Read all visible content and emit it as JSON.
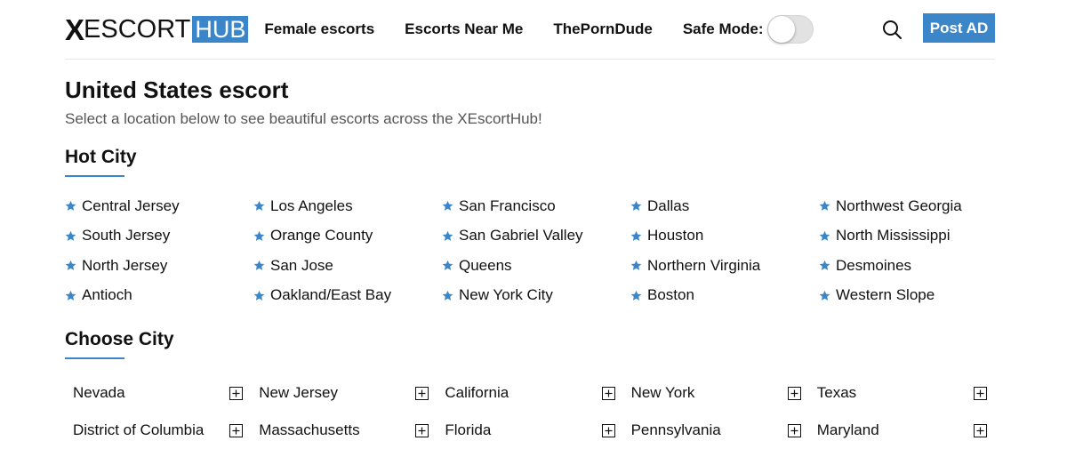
{
  "header": {
    "logo_x": "X",
    "logo_escort": "ESCORT",
    "logo_hub": "HUB",
    "nav": [
      "Female escorts",
      "Escorts Near Me",
      "ThePornDude"
    ],
    "safe_mode_label": "Safe Mode:",
    "safe_mode_on": false,
    "post_label": "Post AD",
    "accent_color": "#3a86c8"
  },
  "page": {
    "title": "United States escort",
    "subtitle": "Select a location below to see beautiful escorts across the XEscortHub!"
  },
  "hot_city": {
    "heading": "Hot City",
    "rows": [
      [
        "Central Jersey",
        "Los Angeles",
        "San Francisco",
        "Dallas",
        "Northwest Georgia"
      ],
      [
        "South Jersey",
        "Orange County",
        "San Gabriel Valley",
        "Houston",
        "North Mississippi"
      ],
      [
        "North Jersey",
        "San Jose",
        "Queens",
        "Northern Virginia",
        "Desmoines"
      ],
      [
        "Antioch",
        "Oakland/East Bay",
        "New York City",
        "Boston",
        "Western Slope"
      ]
    ]
  },
  "choose_city": {
    "heading": "Choose City",
    "rows": [
      [
        "Nevada",
        "New Jersey",
        "California",
        "New York",
        "Texas"
      ],
      [
        "District of Columbia",
        "Massachusetts",
        "Florida",
        "Pennsylvania",
        "Maryland"
      ]
    ]
  }
}
